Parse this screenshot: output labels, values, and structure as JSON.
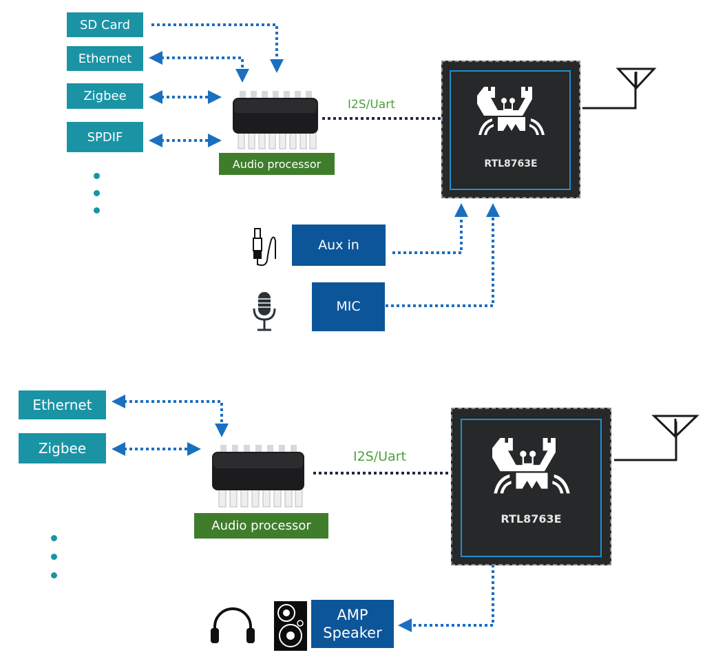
{
  "diagrams": [
    {
      "id": "top",
      "inputs": [
        {
          "label": "SD Card"
        },
        {
          "label": "Ethernet"
        },
        {
          "label": "Zigbee"
        },
        {
          "label": "SPDIF"
        }
      ],
      "more_indicator": "ellipsis-vertical",
      "processor": {
        "label": "Audio processor"
      },
      "link_label": "I2S/Uart",
      "soc": {
        "label": "RTL8763E",
        "logo": "realtek-crab-logo"
      },
      "antenna": "antenna-icon",
      "analog_inputs": [
        {
          "label": "Aux in",
          "icon": "audio-jack-icon"
        },
        {
          "label": "MIC",
          "icon": "microphone-icon"
        }
      ]
    },
    {
      "id": "bottom",
      "inputs": [
        {
          "label": "Ethernet"
        },
        {
          "label": "Zigbee"
        }
      ],
      "more_indicator": "ellipsis-vertical",
      "processor": {
        "label": "Audio processor"
      },
      "link_label": "I2S/Uart",
      "soc": {
        "label": "RTL8763E",
        "logo": "realtek-crab-logo"
      },
      "antenna": "antenna-icon",
      "output": {
        "label_line1": "AMP",
        "label_line2": "Speaker",
        "icons": [
          "headphones-icon",
          "speaker-icon"
        ]
      }
    }
  ],
  "colors": {
    "teal": "#1a93a5",
    "navy": "#0d5599",
    "green": "#3f7d2b",
    "arrow_blue": "#1a6fbf",
    "proto_green": "#4ba03a",
    "chip": "#262829",
    "chip_border": "#1f8fcf"
  }
}
